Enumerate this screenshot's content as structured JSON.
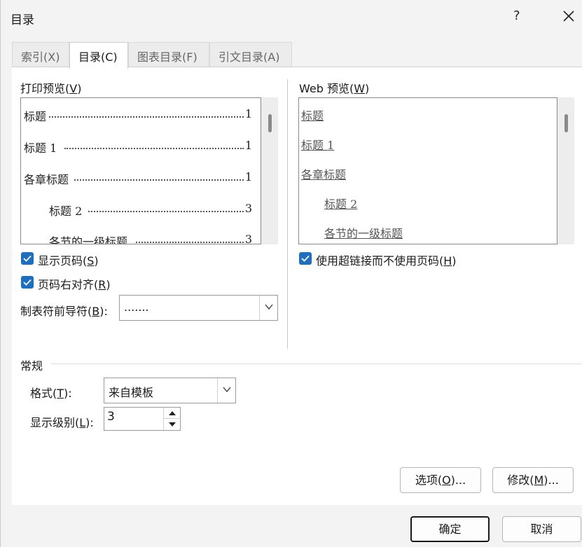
{
  "window": {
    "title": "目录",
    "help_label": "?"
  },
  "tabs": [
    {
      "label": "索引(X)"
    },
    {
      "label": "目录(C)"
    },
    {
      "label": "图表目录(F)"
    },
    {
      "label": "引文目录(A)"
    }
  ],
  "print_preview": {
    "label": "打印预览(",
    "label_key": "V",
    "label_end": ")",
    "lines": [
      {
        "text": "标题",
        "page": "1"
      },
      {
        "text": "标题  1",
        "page": "1"
      },
      {
        "text": "各章标题",
        "page": "1"
      },
      {
        "text": "标题  2",
        "page": "3"
      },
      {
        "text": "各节的一级标题",
        "page": "3"
      }
    ]
  },
  "web_preview": {
    "label": "Web 预览(",
    "label_key": "W",
    "label_end": ")",
    "links": [
      "标题",
      "标题  1",
      "各章标题",
      "标题  2",
      "各节的一级标题"
    ]
  },
  "options": {
    "show_page_numbers": {
      "label": "显示页码(",
      "key": "S",
      "end": ")",
      "checked": true
    },
    "right_align": {
      "label": "页码右对齐(",
      "key": "R",
      "end": ")",
      "checked": true
    },
    "use_hyperlinks": {
      "label": "使用超链接而不使用页码(",
      "key": "H",
      "end": ")",
      "checked": true
    },
    "tab_leader": {
      "label": "制表符前导符(",
      "key": "B",
      "end": "):",
      "value": "......."
    }
  },
  "general": {
    "label": "常规",
    "format_label": "格式(",
    "format_key": "T",
    "format_end": "):",
    "format_value": "来自模板",
    "levels_label": "显示级别(",
    "levels_key": "L",
    "levels_end": "):",
    "levels_value": "3"
  },
  "buttons": {
    "options": "选项(",
    "options_key": "O",
    "options_end": ")...",
    "modify": "修改(",
    "modify_key": "M",
    "modify_end": ")...",
    "ok": "确定",
    "cancel": "取消"
  },
  "colors": {
    "accent": "#1e6fbf",
    "dialog_bg": "#f3f3f3"
  }
}
